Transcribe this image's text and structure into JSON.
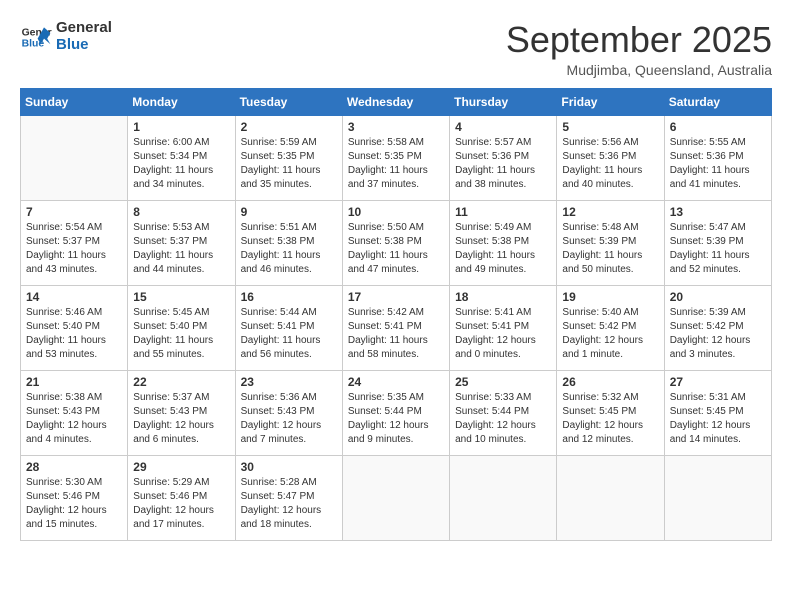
{
  "logo": {
    "line1": "General",
    "line2": "Blue"
  },
  "title": "September 2025",
  "subtitle": "Mudjimba, Queensland, Australia",
  "days_header": [
    "Sunday",
    "Monday",
    "Tuesday",
    "Wednesday",
    "Thursday",
    "Friday",
    "Saturday"
  ],
  "weeks": [
    [
      {
        "day": "",
        "info": ""
      },
      {
        "day": "1",
        "info": "Sunrise: 6:00 AM\nSunset: 5:34 PM\nDaylight: 11 hours\nand 34 minutes."
      },
      {
        "day": "2",
        "info": "Sunrise: 5:59 AM\nSunset: 5:35 PM\nDaylight: 11 hours\nand 35 minutes."
      },
      {
        "day": "3",
        "info": "Sunrise: 5:58 AM\nSunset: 5:35 PM\nDaylight: 11 hours\nand 37 minutes."
      },
      {
        "day": "4",
        "info": "Sunrise: 5:57 AM\nSunset: 5:36 PM\nDaylight: 11 hours\nand 38 minutes."
      },
      {
        "day": "5",
        "info": "Sunrise: 5:56 AM\nSunset: 5:36 PM\nDaylight: 11 hours\nand 40 minutes."
      },
      {
        "day": "6",
        "info": "Sunrise: 5:55 AM\nSunset: 5:36 PM\nDaylight: 11 hours\nand 41 minutes."
      }
    ],
    [
      {
        "day": "7",
        "info": "Sunrise: 5:54 AM\nSunset: 5:37 PM\nDaylight: 11 hours\nand 43 minutes."
      },
      {
        "day": "8",
        "info": "Sunrise: 5:53 AM\nSunset: 5:37 PM\nDaylight: 11 hours\nand 44 minutes."
      },
      {
        "day": "9",
        "info": "Sunrise: 5:51 AM\nSunset: 5:38 PM\nDaylight: 11 hours\nand 46 minutes."
      },
      {
        "day": "10",
        "info": "Sunrise: 5:50 AM\nSunset: 5:38 PM\nDaylight: 11 hours\nand 47 minutes."
      },
      {
        "day": "11",
        "info": "Sunrise: 5:49 AM\nSunset: 5:38 PM\nDaylight: 11 hours\nand 49 minutes."
      },
      {
        "day": "12",
        "info": "Sunrise: 5:48 AM\nSunset: 5:39 PM\nDaylight: 11 hours\nand 50 minutes."
      },
      {
        "day": "13",
        "info": "Sunrise: 5:47 AM\nSunset: 5:39 PM\nDaylight: 11 hours\nand 52 minutes."
      }
    ],
    [
      {
        "day": "14",
        "info": "Sunrise: 5:46 AM\nSunset: 5:40 PM\nDaylight: 11 hours\nand 53 minutes."
      },
      {
        "day": "15",
        "info": "Sunrise: 5:45 AM\nSunset: 5:40 PM\nDaylight: 11 hours\nand 55 minutes."
      },
      {
        "day": "16",
        "info": "Sunrise: 5:44 AM\nSunset: 5:41 PM\nDaylight: 11 hours\nand 56 minutes."
      },
      {
        "day": "17",
        "info": "Sunrise: 5:42 AM\nSunset: 5:41 PM\nDaylight: 11 hours\nand 58 minutes."
      },
      {
        "day": "18",
        "info": "Sunrise: 5:41 AM\nSunset: 5:41 PM\nDaylight: 12 hours\nand 0 minutes."
      },
      {
        "day": "19",
        "info": "Sunrise: 5:40 AM\nSunset: 5:42 PM\nDaylight: 12 hours\nand 1 minute."
      },
      {
        "day": "20",
        "info": "Sunrise: 5:39 AM\nSunset: 5:42 PM\nDaylight: 12 hours\nand 3 minutes."
      }
    ],
    [
      {
        "day": "21",
        "info": "Sunrise: 5:38 AM\nSunset: 5:43 PM\nDaylight: 12 hours\nand 4 minutes."
      },
      {
        "day": "22",
        "info": "Sunrise: 5:37 AM\nSunset: 5:43 PM\nDaylight: 12 hours\nand 6 minutes."
      },
      {
        "day": "23",
        "info": "Sunrise: 5:36 AM\nSunset: 5:43 PM\nDaylight: 12 hours\nand 7 minutes."
      },
      {
        "day": "24",
        "info": "Sunrise: 5:35 AM\nSunset: 5:44 PM\nDaylight: 12 hours\nand 9 minutes."
      },
      {
        "day": "25",
        "info": "Sunrise: 5:33 AM\nSunset: 5:44 PM\nDaylight: 12 hours\nand 10 minutes."
      },
      {
        "day": "26",
        "info": "Sunrise: 5:32 AM\nSunset: 5:45 PM\nDaylight: 12 hours\nand 12 minutes."
      },
      {
        "day": "27",
        "info": "Sunrise: 5:31 AM\nSunset: 5:45 PM\nDaylight: 12 hours\nand 14 minutes."
      }
    ],
    [
      {
        "day": "28",
        "info": "Sunrise: 5:30 AM\nSunset: 5:46 PM\nDaylight: 12 hours\nand 15 minutes."
      },
      {
        "day": "29",
        "info": "Sunrise: 5:29 AM\nSunset: 5:46 PM\nDaylight: 12 hours\nand 17 minutes."
      },
      {
        "day": "30",
        "info": "Sunrise: 5:28 AM\nSunset: 5:47 PM\nDaylight: 12 hours\nand 18 minutes."
      },
      {
        "day": "",
        "info": ""
      },
      {
        "day": "",
        "info": ""
      },
      {
        "day": "",
        "info": ""
      },
      {
        "day": "",
        "info": ""
      }
    ]
  ]
}
